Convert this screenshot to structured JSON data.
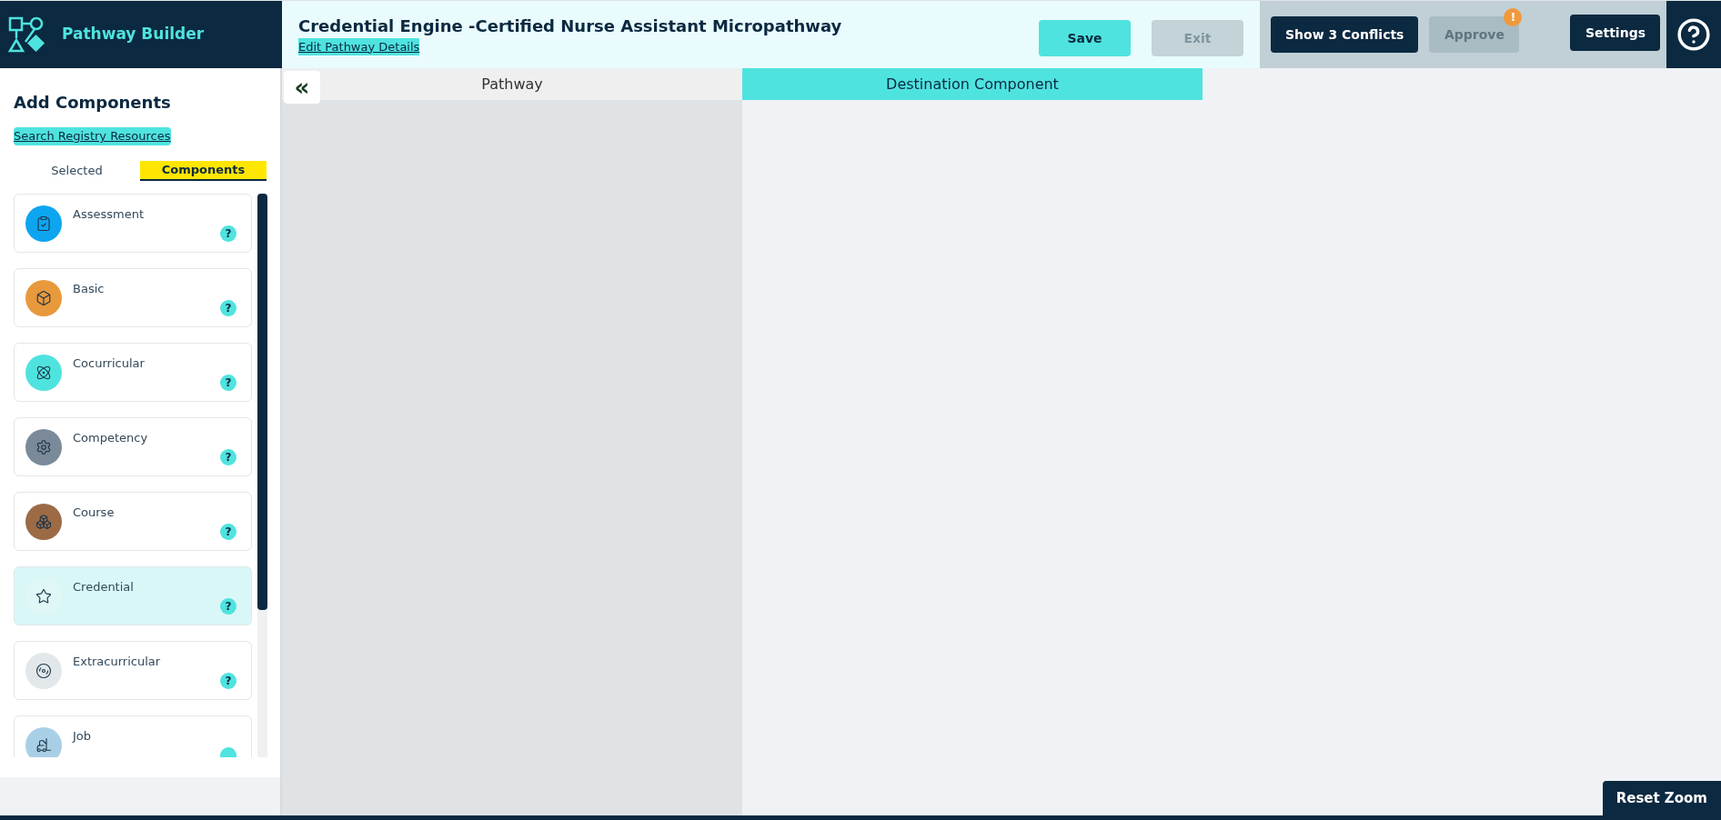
{
  "app": {
    "name": "Pathway Builder"
  },
  "header": {
    "title": "Credential Engine -Certified Nurse Assistant Micropathway",
    "link": "Edit Pathway Details",
    "buttons": [
      {
        "label": "Save",
        "disabled": false,
        "kind": "primary"
      },
      {
        "label": "Exit",
        "disabled": true,
        "kind": "primary"
      },
      {
        "label": "Show 3 Conflicts",
        "disabled": false,
        "kind": "dark"
      },
      {
        "label": "Approve",
        "disabled": true,
        "kind": "dark",
        "badge": "!"
      },
      {
        "label": "Settings",
        "disabled": false,
        "kind": "dark"
      }
    ]
  },
  "sidebar": {
    "title": "Add Components",
    "link": "Search Registry Resources",
    "tabs": [
      {
        "label": "Selected",
        "selected": false
      },
      {
        "label": "Components",
        "selected": true
      }
    ],
    "items": [
      {
        "label": "Assessment",
        "color": "#0ea5f0",
        "selected": false,
        "help": "?"
      },
      {
        "label": "Basic",
        "color": "#e8993c",
        "selected": false,
        "help": "?"
      },
      {
        "label": "Cocurricular",
        "color": "#4fe3df",
        "selected": false,
        "help": "?"
      },
      {
        "label": "Competency",
        "color": "#7a8a99",
        "selected": false,
        "help": "?"
      },
      {
        "label": "Course",
        "color": "#9c6b45",
        "selected": false,
        "help": "?"
      },
      {
        "label": "Credential",
        "color": "#e0f7f7",
        "selected": true,
        "help": "?"
      },
      {
        "label": "Extracurricular",
        "color": "#e2e8ea",
        "selected": false,
        "help": "?"
      },
      {
        "label": "Job",
        "color": "#a9cfe6",
        "selected": false
      }
    ]
  },
  "canvas": {
    "collapse": "«",
    "columns": [
      {
        "label": "Pathway",
        "kind": "pathway"
      },
      {
        "label": "Destination Component",
        "kind": "destination"
      }
    ]
  },
  "reset_zoom": "Reset Zoom"
}
